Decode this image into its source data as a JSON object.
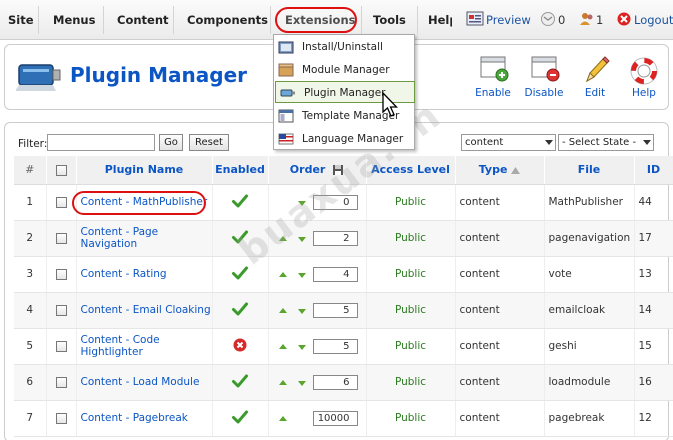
{
  "menubar": {
    "items": [
      "Site",
      "Menus",
      "Content",
      "Components",
      "Extensions",
      "Tools",
      "Help"
    ],
    "preview_label": "Preview",
    "messages_count": "0",
    "users_count": "1",
    "logout_label": "Logout"
  },
  "extensions_menu": {
    "items": [
      "Install/Uninstall",
      "Module Manager",
      "Plugin Manager",
      "Template Manager",
      "Language Manager"
    ],
    "active_index": 2
  },
  "header": {
    "title": "Plugin Manager",
    "toolbar": {
      "enable_label": "Enable",
      "disable_label": "Disable",
      "edit_label": "Edit",
      "help_label": "Help"
    }
  },
  "filter": {
    "label": "Filter:",
    "value": "",
    "go_label": "Go",
    "reset_label": "Reset",
    "type_select": "content",
    "state_select": "- Select State -"
  },
  "table": {
    "headers": {
      "num": "#",
      "name": "Plugin Name",
      "enabled": "Enabled",
      "order": "Order",
      "access": "Access Level",
      "type": "Type",
      "file": "File",
      "id": "ID"
    },
    "rows": [
      {
        "num": "1",
        "name": "Content - MathPublisher",
        "enabled": true,
        "order": "0",
        "access": "Public",
        "type": "content",
        "file": "MathPublisher",
        "id": "44"
      },
      {
        "num": "2",
        "name": "Content - Page Navigation",
        "enabled": true,
        "order": "2",
        "access": "Public",
        "type": "content",
        "file": "pagenavigation",
        "id": "17"
      },
      {
        "num": "3",
        "name": "Content - Rating",
        "enabled": true,
        "order": "4",
        "access": "Public",
        "type": "content",
        "file": "vote",
        "id": "13"
      },
      {
        "num": "4",
        "name": "Content - Email Cloaking",
        "enabled": true,
        "order": "5",
        "access": "Public",
        "type": "content",
        "file": "emailcloak",
        "id": "14"
      },
      {
        "num": "5",
        "name": "Content - Code Hightlighter",
        "enabled": false,
        "order": "5",
        "access": "Public",
        "type": "content",
        "file": "geshi",
        "id": "15"
      },
      {
        "num": "6",
        "name": "Content - Load Module",
        "enabled": true,
        "order": "6",
        "access": "Public",
        "type": "content",
        "file": "loadmodule",
        "id": "16"
      },
      {
        "num": "7",
        "name": "Content - Pagebreak",
        "enabled": true,
        "order": "10000",
        "access": "Public",
        "type": "content",
        "file": "pagebreak",
        "id": "12"
      }
    ]
  },
  "watermark": "buaxua.vn",
  "colors": {
    "link_blue": "#0b55c4",
    "access_green": "#2a7a1f",
    "highlight_red": "#dd1111"
  }
}
